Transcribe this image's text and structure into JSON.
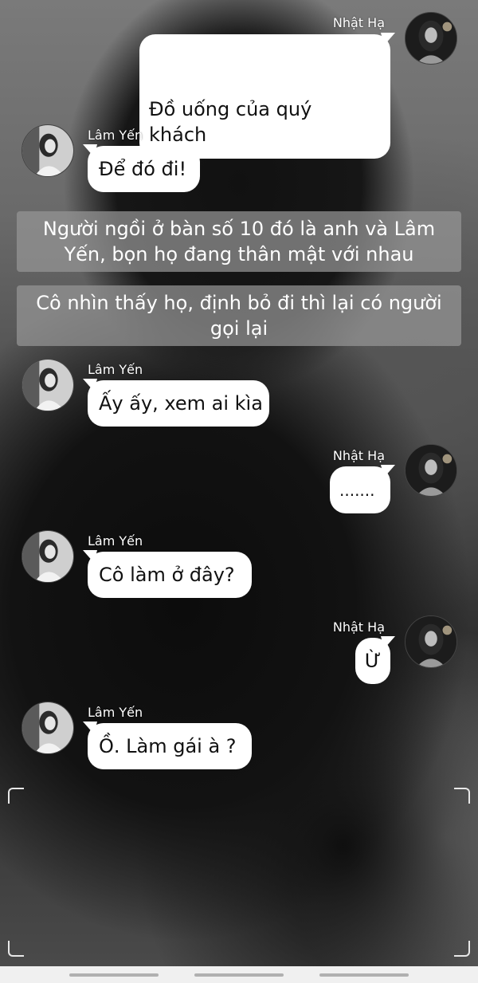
{
  "characters": {
    "right": "Nhật Hạ",
    "left": "Lâm Yến"
  },
  "messages": [
    {
      "side": "right",
      "name": "Nhật Hạ",
      "text": "Đồ uống của quý\nkhách"
    },
    {
      "side": "left",
      "name": "Lâm Yến",
      "text": "Để đó đi!"
    },
    {
      "side": "narration",
      "text": "Người ngồi ở bàn số 10 đó là anh và Lâm Yến, bọn họ đang thân mật với nhau"
    },
    {
      "side": "narration",
      "text": "Cô nhìn thấy họ, định bỏ đi thì lại có người gọi lại"
    },
    {
      "side": "left",
      "name": "Lâm Yến",
      "text": "Ấy ấy, xem ai kìa"
    },
    {
      "side": "right",
      "name": "Nhật Hạ",
      "text": "......."
    },
    {
      "side": "left",
      "name": "Lâm Yến",
      "text": "Cô làm ở đây?"
    },
    {
      "side": "right",
      "name": "Nhật Hạ",
      "text": "Ừ"
    },
    {
      "side": "left",
      "name": "Lâm Yến",
      "text": "Ồ. Làm gái à ?"
    }
  ],
  "colors": {
    "bubble": "#ffffff",
    "narration_bg": "#969696",
    "name_text": "#ffffff"
  }
}
